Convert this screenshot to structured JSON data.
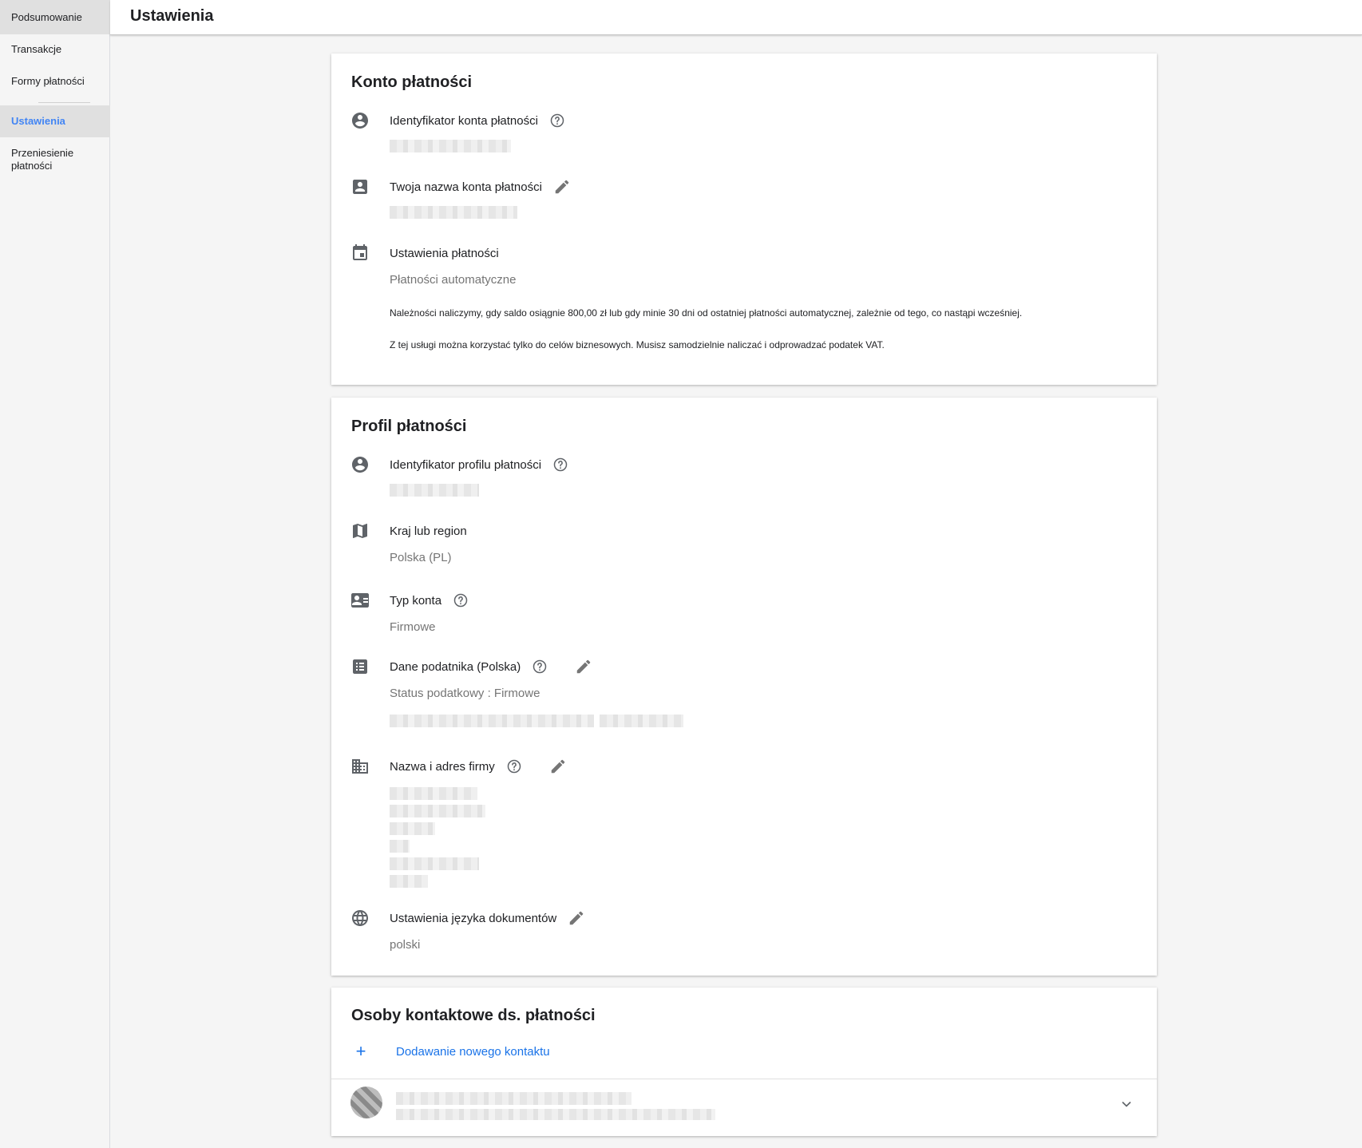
{
  "sidebar": {
    "items": [
      {
        "label": "Podsumowanie"
      },
      {
        "label": "Transakcje"
      },
      {
        "label": "Formy płatności"
      },
      {
        "label": "Ustawienia"
      },
      {
        "label": "Przeniesienie płatności"
      }
    ],
    "active_color": "#4285f4"
  },
  "header": {
    "title": "Ustawienia"
  },
  "billing_account": {
    "title": "Konto płatności",
    "id_label": "Identyfikator konta płatności",
    "name_label": "Twoja nazwa konta płatności",
    "settings_label": "Ustawienia płatności",
    "settings_value": "Płatności automatyczne",
    "note1": "Należności naliczymy, gdy saldo osiągnie 800,00 zł lub gdy minie 30 dni od ostatniej płatności automatycznej, zależnie od tego, co nastąpi wcześniej.",
    "note2": "Z tej usługi można korzystać tylko do celów biznesowych. Musisz samodzielnie naliczać i odprowadzać podatek VAT."
  },
  "payments_profile": {
    "title": "Profil płatności",
    "id_label": "Identyfikator profilu płatności",
    "country_label": "Kraj lub region",
    "country_value": "Polska (PL)",
    "account_type_label": "Typ konta",
    "account_type_value": "Firmowe",
    "tax_label": "Dane podatnika (Polska)",
    "tax_status": "Status podatkowy : Firmowe",
    "company_label": "Nazwa i adres firmy",
    "language_label": "Ustawienia języka dokumentów",
    "language_value": "polski"
  },
  "contacts": {
    "title": "Osoby kontaktowe ds. płatności",
    "add_label": "Dodawanie nowego kontaktu",
    "link_color": "#1a73e8"
  },
  "icons": [
    "account-circle-icon",
    "contact-card-icon",
    "calendar-icon",
    "map-icon",
    "id-card-icon",
    "list-icon",
    "building-icon",
    "globe-icon",
    "help-icon",
    "edit-icon",
    "plus-icon",
    "chevron-down-icon"
  ]
}
